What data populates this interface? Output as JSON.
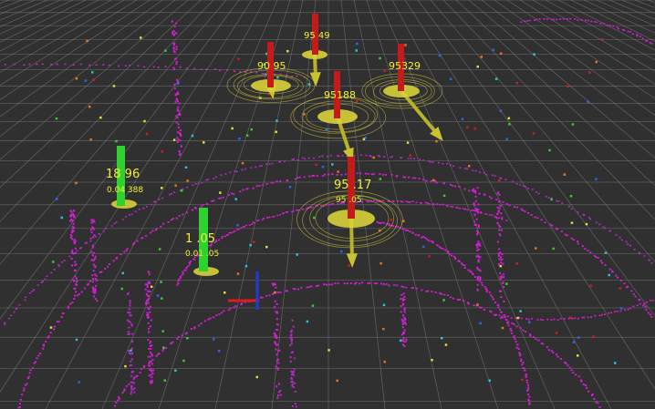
{
  "scene": {
    "colors": {
      "background": "#303030",
      "grid": "#8a8a8a",
      "lidar_main": "#d21fd2",
      "lidar_alt": "#b626c8",
      "marker_red": "#c41a1a",
      "marker_green": "#2fd12f",
      "label_text": "#f2ef3a",
      "disc_yellow": "#d8d23a",
      "axis_red": "#e01d1d",
      "axis_blue": "#1f3bd8"
    },
    "tracks": [
      {
        "id": "t1",
        "color": "red",
        "label": "90 95",
        "sub": ""
      },
      {
        "id": "t2",
        "color": "red",
        "label": "95 49",
        "sub": ""
      },
      {
        "id": "t3",
        "color": "red",
        "label": "95329",
        "sub": ""
      },
      {
        "id": "t4",
        "color": "red",
        "label": "95188",
        "sub": ""
      },
      {
        "id": "t5",
        "color": "red",
        "label": "95 .17",
        "sub": "95 .05"
      },
      {
        "id": "t6",
        "color": "green",
        "label": "18 96",
        "sub": "0.04 388"
      },
      {
        "id": "t7",
        "color": "green",
        "label": "1 .05",
        "sub": "0.01 .05"
      }
    ]
  }
}
